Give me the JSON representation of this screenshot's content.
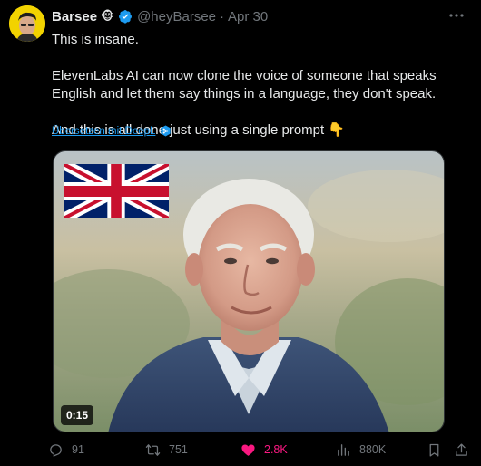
{
  "tweet": {
    "author_name": "Barsee",
    "author_emoji": "🐵",
    "handle": "@heyBarsee",
    "separator": "·",
    "date": "Apr 30",
    "lines": [
      "This is insane.",
      "ElevenLabs AI can now clone the voice of someone that speaks English and let them say things in a language, they don't speak.",
      "And this is all done just using a single prompt"
    ],
    "pointing_emoji": "👇",
    "translate_label": "Übersetzen mit DeepL"
  },
  "media": {
    "duration": "0:15"
  },
  "actions": {
    "replies": "91",
    "reposts": "751",
    "likes": "2.8K",
    "views": "880K"
  },
  "colors": {
    "background": "#000000",
    "text": "#e7e9ea",
    "muted": "#71767b",
    "accent": "#1d9bf0",
    "like": "#f91880"
  },
  "icons": [
    "more-icon",
    "verified-badge-icon",
    "deepl-icon",
    "reply-icon",
    "repost-icon",
    "like-icon",
    "views-icon",
    "bookmark-icon",
    "share-icon"
  ]
}
